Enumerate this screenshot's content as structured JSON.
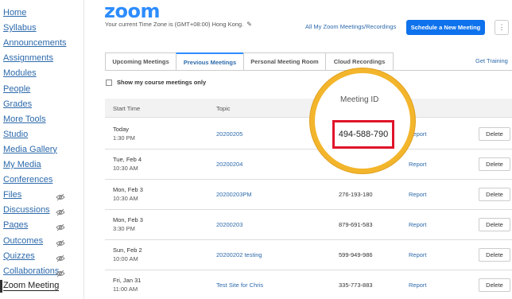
{
  "sidebar": {
    "items": [
      {
        "label": "Home",
        "hidden": false
      },
      {
        "label": "Syllabus",
        "hidden": false
      },
      {
        "label": "Announcements",
        "hidden": false
      },
      {
        "label": "Assignments",
        "hidden": false
      },
      {
        "label": "Modules",
        "hidden": false
      },
      {
        "label": "People",
        "hidden": false
      },
      {
        "label": "Grades",
        "hidden": false
      },
      {
        "label": "More Tools",
        "hidden": false
      },
      {
        "label": "Studio",
        "hidden": false
      },
      {
        "label": "Media Gallery",
        "hidden": false
      },
      {
        "label": "My Media",
        "hidden": false
      },
      {
        "label": "Conferences",
        "hidden": false
      },
      {
        "label": "Files",
        "hidden": true
      },
      {
        "label": "Discussions",
        "hidden": true
      },
      {
        "label": "Pages",
        "hidden": true
      },
      {
        "label": "Outcomes",
        "hidden": true
      },
      {
        "label": "Quizzes",
        "hidden": true
      },
      {
        "label": "Collaborations",
        "hidden": true
      },
      {
        "label": "Zoom Meeting",
        "hidden": false,
        "active": true
      }
    ]
  },
  "header": {
    "logo": "zoom",
    "timezone": "Your current Time Zone is (GMT+08:00) Hong Kong.",
    "all_link": "All My Zoom Meetings/Recordings",
    "schedule_button": "Schedule a New Meeting",
    "more_button": "⋮"
  },
  "tabs": [
    {
      "label": "Upcoming Meetings",
      "active": false
    },
    {
      "label": "Previous Meetings",
      "active": true
    },
    {
      "label": "Personal Meeting Room",
      "active": false
    },
    {
      "label": "Cloud Recordings",
      "active": false
    }
  ],
  "get_training": "Get Training",
  "filter": {
    "label": "Show my course meetings only",
    "checked": false
  },
  "table": {
    "headers": {
      "start_time": "Start Time",
      "topic": "Topic",
      "meeting_id": "Meeting ID"
    },
    "rows": [
      {
        "day": "Today",
        "time": "1:30 PM",
        "topic": "20200205",
        "meeting_id": "494-588-790",
        "report": "Report",
        "delete": "Delete"
      },
      {
        "day": "Tue, Feb 4",
        "time": "10:30 AM",
        "topic": "20200204",
        "meeting_id": "",
        "report": "Report",
        "delete": "Delete"
      },
      {
        "day": "Mon, Feb 3",
        "time": "10:30 AM",
        "topic": "20200203PM",
        "meeting_id": "276-193-180",
        "report": "Report",
        "delete": "Delete"
      },
      {
        "day": "Mon, Feb 3",
        "time": "3:30 PM",
        "topic": "20200203",
        "meeting_id": "879-691-583",
        "report": "Report",
        "delete": "Delete"
      },
      {
        "day": "Sun, Feb 2",
        "time": "10:00 AM",
        "topic": "20200202 testing",
        "meeting_id": "599-949-986",
        "report": "Report",
        "delete": "Delete"
      },
      {
        "day": "Fri, Jan 31",
        "time": "11:00 AM",
        "topic": "Test Site for Chris",
        "meeting_id": "335-773-883",
        "report": "Report",
        "delete": "Delete"
      }
    ]
  },
  "callout": {
    "title": "Meeting ID",
    "value": "494-588-790"
  },
  "colors": {
    "accent": "#2d8cff",
    "button": "#0e72ed",
    "link": "#2d6aab",
    "highlight_circle": "#f3b52b",
    "highlight_box": "#e0142a"
  }
}
